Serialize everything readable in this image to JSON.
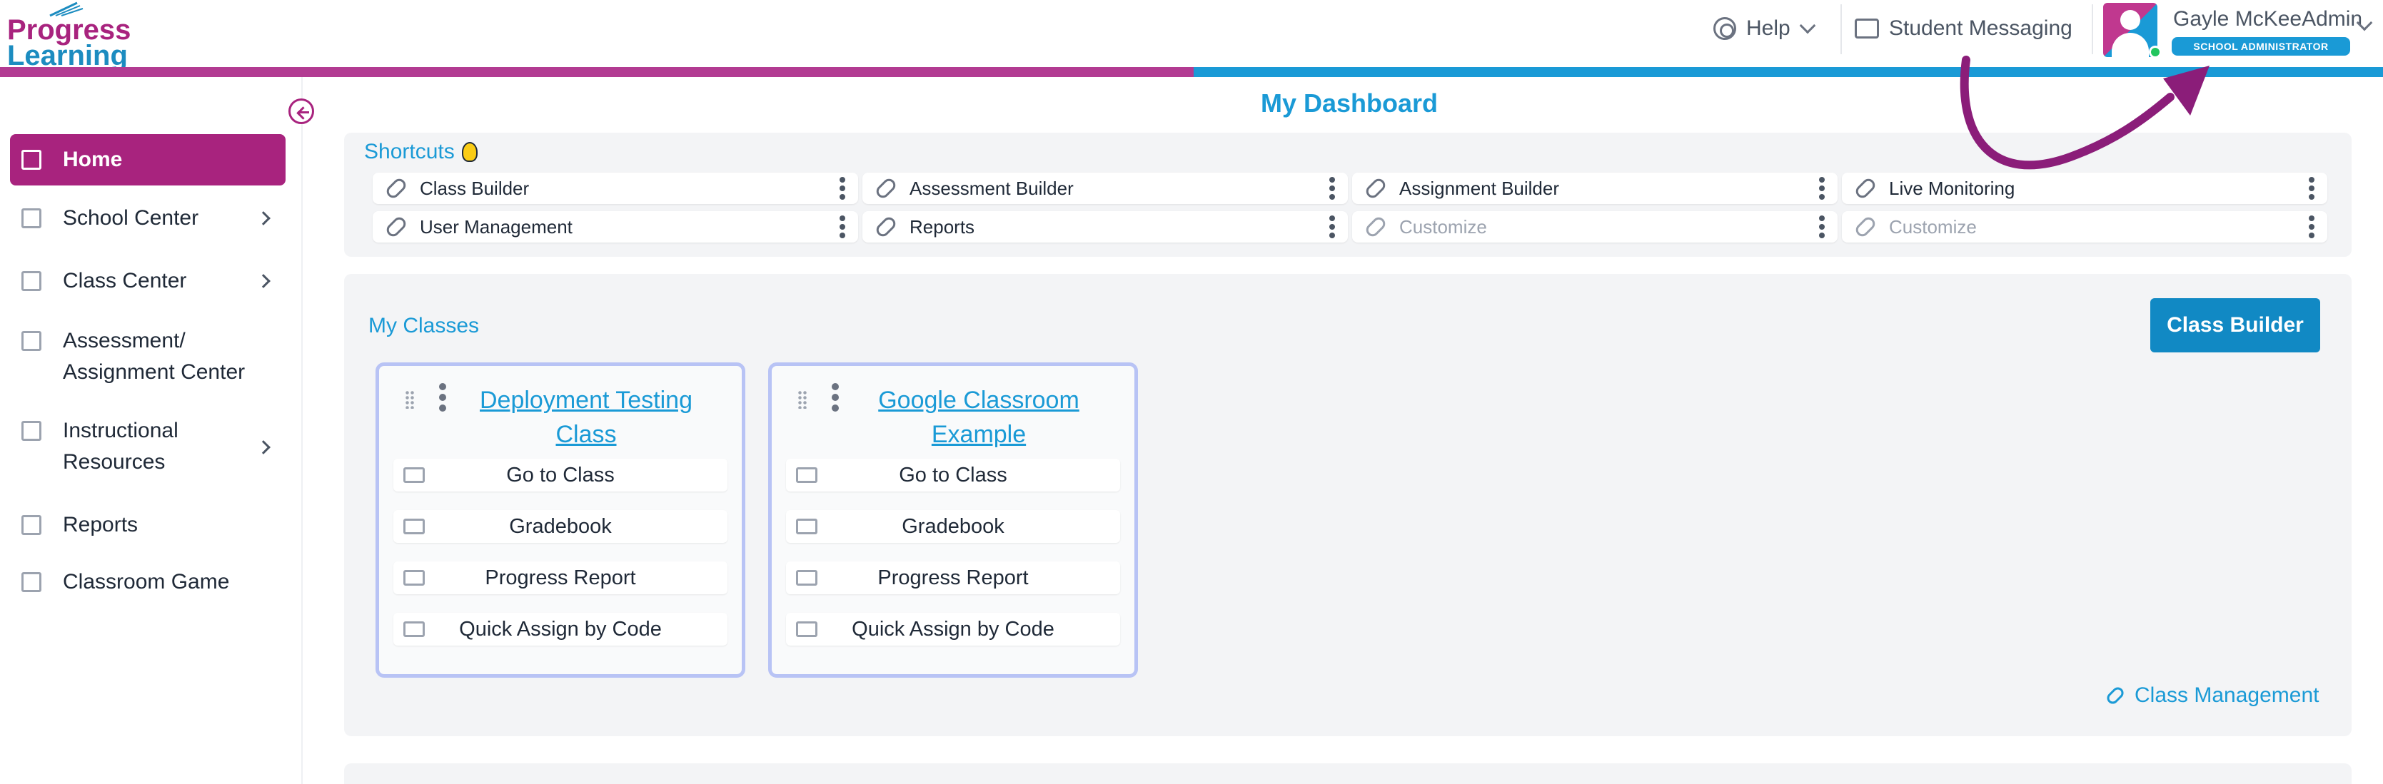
{
  "header": {
    "logo_line1": "Progress",
    "logo_line2": "Learning",
    "help_label": "Help",
    "messaging_label": "Student Messaging",
    "user_name": "Gayle McKeeAdmin",
    "user_role": "SCHOOL ADMINISTRATOR"
  },
  "sidebar": {
    "items": [
      {
        "label": "Home",
        "icon": "home-icon"
      },
      {
        "label": "School Center",
        "icon": "school-icon"
      },
      {
        "label": "Class Center",
        "icon": "class-icon"
      },
      {
        "label": "Assessment/",
        "label2": "Assignment Center",
        "icon": "book-icon"
      },
      {
        "label": "Instructional",
        "label2": "Resources",
        "icon": "resources-icon"
      },
      {
        "label": "Reports",
        "icon": "report-icon"
      },
      {
        "label": "Classroom Game",
        "icon": "game-icon"
      }
    ]
  },
  "main": {
    "title": "My Dashboard",
    "shortcuts": {
      "title": "Shortcuts",
      "items": [
        "Class Builder",
        "Assessment Builder",
        "Assignment Builder",
        "Live Monitoring",
        "User Management",
        "Reports",
        "Customize",
        "Customize"
      ]
    },
    "my_classes": {
      "title": "My Classes",
      "class_builder_button": "Class Builder",
      "class_management_link": "Class Management",
      "cards": [
        {
          "title_line1": "Deployment Testing",
          "title_line2": "Class",
          "actions": [
            "Go to Class",
            "Gradebook",
            "Progress Report",
            "Quick Assign by Code"
          ]
        },
        {
          "title_line1": "Google Classroom",
          "title_line2": "Example",
          "actions": [
            "Go to Class",
            "Gradebook",
            "Progress Report",
            "Quick Assign by Code"
          ]
        }
      ]
    }
  },
  "colors": {
    "brand_pink": "#a8237e",
    "brand_blue": "#1a9ad6",
    "panel_bg": "#f3f4f6",
    "annotation_arrow": "#8b1d79"
  }
}
